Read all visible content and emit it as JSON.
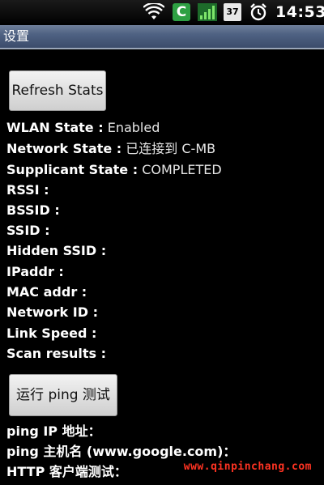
{
  "status_bar": {
    "time": "14:53",
    "battery_level": "37",
    "app_icon_letter": "C",
    "icons": [
      "wifi-icon",
      "c-app-icon",
      "signal-icon",
      "battery-icon",
      "alarm-clock-icon"
    ]
  },
  "title_bar": {
    "title": "设置"
  },
  "buttons": {
    "refresh": "Refresh Stats",
    "ping": "运行 ping 测试"
  },
  "wlan_info": [
    {
      "label": "WLAN State :",
      "value": "Enabled"
    },
    {
      "label": "Network State :",
      "value": "已连接到 C-MB"
    },
    {
      "label": "Supplicant State :",
      "value": "COMPLETED"
    },
    {
      "label": "RSSI :",
      "value": ""
    },
    {
      "label": "BSSID :",
      "value": ""
    },
    {
      "label": "SSID :",
      "value": ""
    },
    {
      "label": "Hidden SSID :",
      "value": ""
    },
    {
      "label": "IPaddr :",
      "value": ""
    },
    {
      "label": "MAC addr :",
      "value": ""
    },
    {
      "label": "Network ID :",
      "value": ""
    },
    {
      "label": "Link Speed :",
      "value": ""
    },
    {
      "label": "Scan results :",
      "value": ""
    }
  ],
  "ping_info": [
    {
      "label": "ping IP 地址：",
      "value": ""
    },
    {
      "label": "ping 主机名 (www.google.com)：",
      "value": ""
    },
    {
      "label": "HTTP 客户端测试：",
      "value": ""
    }
  ],
  "watermark": "www.qinpinchang.com",
  "colors": {
    "background": "#000000",
    "title_bar": "#4f6283",
    "watermark": "#ff3322",
    "app_icon": "#2ea043"
  }
}
